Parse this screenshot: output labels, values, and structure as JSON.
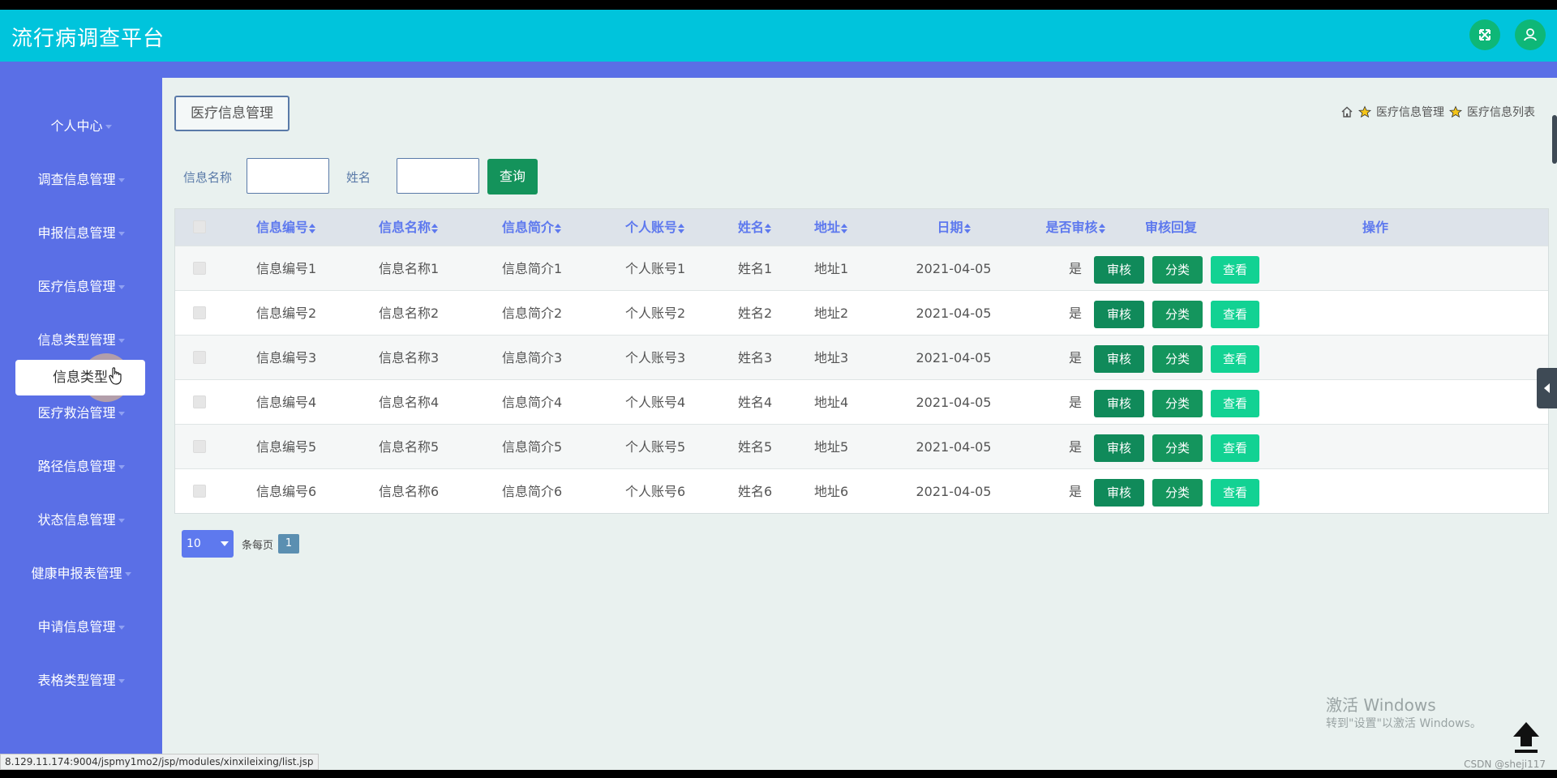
{
  "app": {
    "title": "流行病调查平台"
  },
  "header": {
    "fullscreen_icon": "expand-icon",
    "user_icon": "user-icon"
  },
  "sidebar": {
    "items": [
      {
        "label": "个人中心"
      },
      {
        "label": "调查信息管理"
      },
      {
        "label": "申报信息管理"
      },
      {
        "label": "医疗信息管理"
      },
      {
        "label": "信息类型管理"
      },
      {
        "label": "医疗救治管理"
      },
      {
        "label": "路径信息管理"
      },
      {
        "label": "状态信息管理"
      },
      {
        "label": "健康申报表管理"
      },
      {
        "label": "申请信息管理"
      },
      {
        "label": "表格类型管理"
      }
    ],
    "active_submenu": "信息类型"
  },
  "page": {
    "title": "医疗信息管理",
    "breadcrumb": [
      "医疗信息管理",
      "医疗信息列表"
    ]
  },
  "search": {
    "field1_label": "信息名称",
    "field1_value": "",
    "field2_label": "姓名",
    "field2_value": "",
    "button_label": "查询"
  },
  "table": {
    "columns": [
      "信息编号",
      "信息名称",
      "信息简介",
      "个人账号",
      "姓名",
      "地址",
      "日期",
      "是否审核",
      "审核回复",
      "操作"
    ],
    "rows": [
      {
        "id": "信息编号1",
        "name": "信息名称1",
        "intro": "信息简介1",
        "account": "个人账号1",
        "person": "姓名1",
        "addr": "地址1",
        "date": "2021-04-05",
        "reviewed": "是",
        "reply": ""
      },
      {
        "id": "信息编号2",
        "name": "信息名称2",
        "intro": "信息简介2",
        "account": "个人账号2",
        "person": "姓名2",
        "addr": "地址2",
        "date": "2021-04-05",
        "reviewed": "是",
        "reply": ""
      },
      {
        "id": "信息编号3",
        "name": "信息名称3",
        "intro": "信息简介3",
        "account": "个人账号3",
        "person": "姓名3",
        "addr": "地址3",
        "date": "2021-04-05",
        "reviewed": "是",
        "reply": ""
      },
      {
        "id": "信息编号4",
        "name": "信息名称4",
        "intro": "信息简介4",
        "account": "个人账号4",
        "person": "姓名4",
        "addr": "地址4",
        "date": "2021-04-05",
        "reviewed": "是",
        "reply": ""
      },
      {
        "id": "信息编号5",
        "name": "信息名称5",
        "intro": "信息简介5",
        "account": "个人账号5",
        "person": "姓名5",
        "addr": "地址5",
        "date": "2021-04-05",
        "reviewed": "是",
        "reply": ""
      },
      {
        "id": "信息编号6",
        "name": "信息名称6",
        "intro": "信息简介6",
        "account": "个人账号6",
        "person": "姓名6",
        "addr": "地址6",
        "date": "2021-04-05",
        "reviewed": "是",
        "reply": ""
      }
    ],
    "actions": {
      "review": "审核",
      "classify": "分类",
      "view": "查看"
    }
  },
  "pagination": {
    "page_size": "10",
    "per_page_label": "条每页",
    "current_page": "1"
  },
  "watermark": {
    "title": "激活 Windows",
    "subtitle": "转到\"设置\"以激活 Windows。"
  },
  "status_url": "8.129.11.174:9004/jspmy1mo2/jsp/modules/xinxileixing/list.jsp",
  "csdn": "CSDN @sheji117",
  "colors": {
    "header": "#00c4dc",
    "sidebar": "#5a6fe6",
    "primary_button": "#14935b",
    "view_button": "#12d293"
  }
}
